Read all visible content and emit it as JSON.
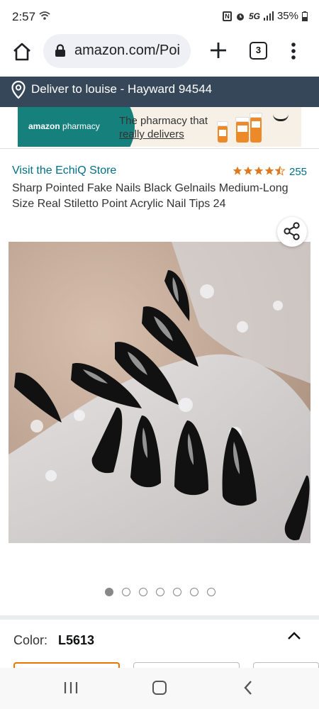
{
  "status_bar": {
    "time": "2:57",
    "nfc": "N",
    "network": "5G",
    "battery": "35%"
  },
  "browser": {
    "url": "amazon.com/Poi",
    "tab_count": "3"
  },
  "deliver": {
    "text": "Deliver to louise - Hayward 94544"
  },
  "banner": {
    "logo_prefix": "amazon",
    "logo_suffix": " pharmacy",
    "tagline_line1": "The pharmacy that",
    "tagline_line2": "really delivers"
  },
  "product": {
    "store_link": "Visit the EchiQ Store",
    "rating_stars": 4.5,
    "review_count": "255",
    "title": "Sharp Pointed Fake Nails Black Gelnails Medium-Long Size Real Stiletto Point Acrylic Nail Tips 24",
    "image_count": 7,
    "active_image_index": 0
  },
  "variation": {
    "label": "Color:",
    "value": "L5613"
  },
  "colors": {
    "link": "#007185",
    "star": "#de7921",
    "deliver_bg": "#37475a",
    "selected_swatch": "#e77600",
    "pharmacy_teal": "#16807c"
  },
  "icons": {
    "home": "home-icon",
    "lock": "lock-icon",
    "new_tab": "plus-icon",
    "tabs": "tabs-icon",
    "menu": "more-vert-icon",
    "location": "location-pin-icon",
    "share": "share-icon",
    "collapse": "chevron-up-icon",
    "nav_recent": "recent-apps-icon",
    "nav_home": "nav-home-icon",
    "nav_back": "back-icon"
  }
}
